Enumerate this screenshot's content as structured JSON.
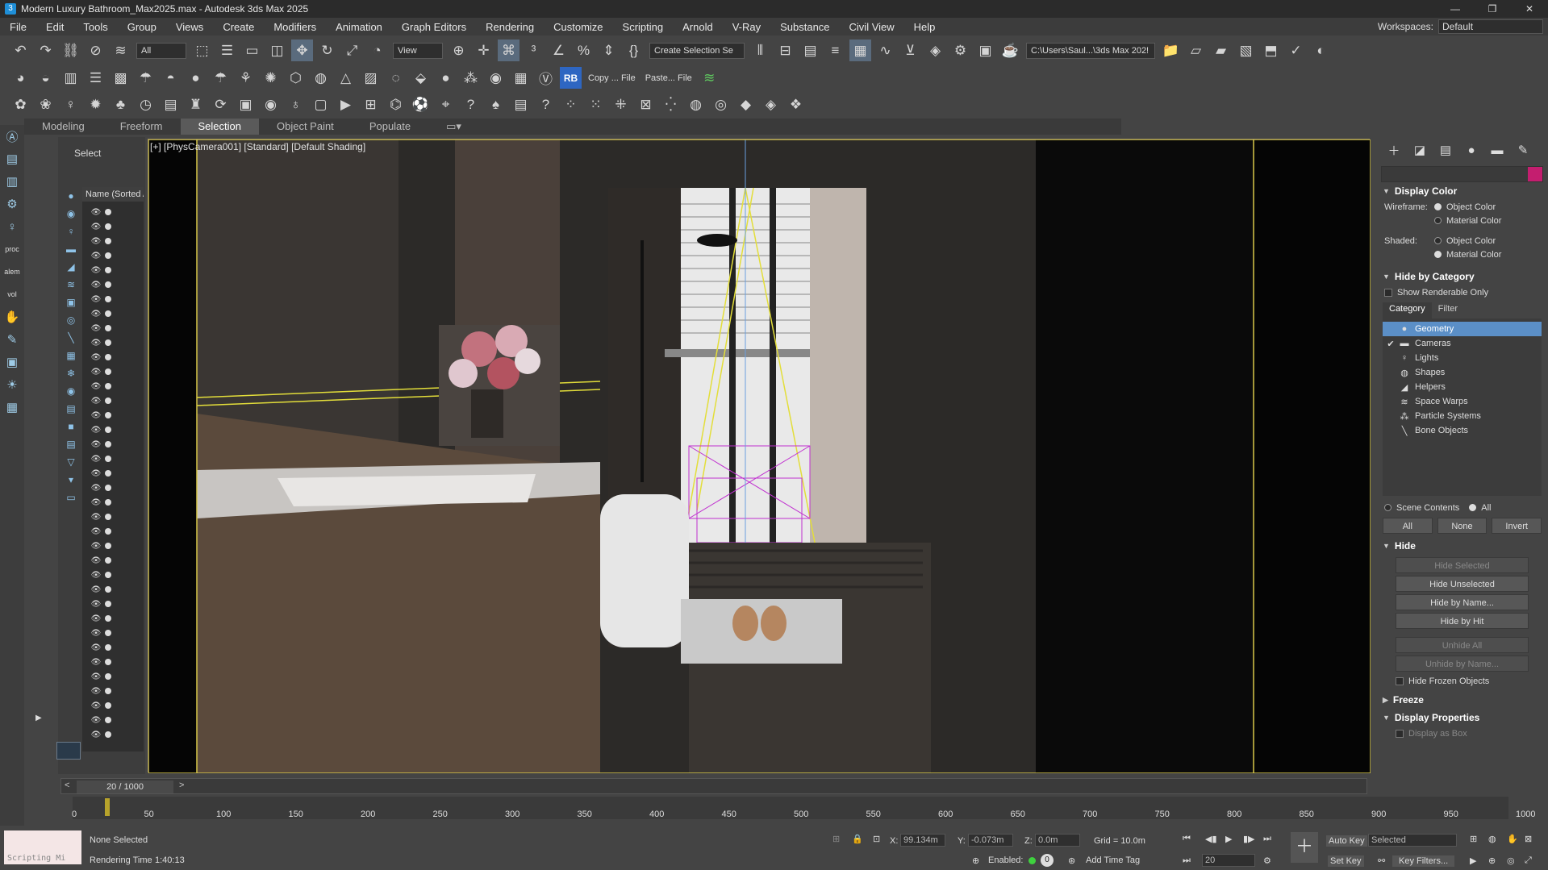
{
  "window": {
    "title": "Modern Luxury Bathroom_Max2025.max - Autodesk 3ds Max 2025",
    "controls": [
      "—",
      "❐",
      "✕"
    ]
  },
  "menu": {
    "items": [
      "File",
      "Edit",
      "Tools",
      "Group",
      "Views",
      "Create",
      "Modifiers",
      "Animation",
      "Graph Editors",
      "Rendering",
      "Customize",
      "Scripting",
      "Arnold",
      "V-Ray",
      "Substance",
      "Civil View",
      "Help"
    ],
    "workspace_label": "Workspaces:",
    "workspace_value": "Default"
  },
  "toolbar1": {
    "filter_value": "All",
    "view_value": "View",
    "selection_set": "Create Selection Se",
    "path_value": "C:\\Users\\Saul...\\3ds Max 202!"
  },
  "toolbar2": {
    "copy_label": "Copy ... File",
    "paste_label": "Paste... File",
    "rb_label": "RB"
  },
  "ribbon": {
    "tabs": [
      "Modeling",
      "Freeform",
      "Selection",
      "Object Paint",
      "Populate"
    ],
    "active": "Selection"
  },
  "left_strip": {
    "labels": [
      "proc",
      "alem",
      "vol"
    ]
  },
  "scene_explorer": {
    "title": "Select",
    "column_header": "Name (Sorted A",
    "rows": 37
  },
  "viewport": {
    "label": "[+] [PhysCamera001] [Standard] [Default Shading]"
  },
  "command_panel": {
    "display_color": {
      "title": "Display Color",
      "wireframe_label": "Wireframe:",
      "shaded_label": "Shaded:",
      "object_color": "Object Color",
      "material_color": "Material Color"
    },
    "hide_by_category": {
      "title": "Hide by Category",
      "show_renderable_only": "Show Renderable Only",
      "tabs": [
        "Category",
        "Filter"
      ],
      "items": [
        {
          "label": "Geometry",
          "checked": false,
          "selected": true,
          "icon": "sphere-icon"
        },
        {
          "label": "Cameras",
          "checked": true,
          "selected": false,
          "icon": "camera-icon"
        },
        {
          "label": "Lights",
          "checked": false,
          "selected": false,
          "icon": "light-icon"
        },
        {
          "label": "Shapes",
          "checked": false,
          "selected": false,
          "icon": "shapes-icon"
        },
        {
          "label": "Helpers",
          "checked": false,
          "selected": false,
          "icon": "helper-icon"
        },
        {
          "label": "Space Warps",
          "checked": false,
          "selected": false,
          "icon": "spacewarp-icon"
        },
        {
          "label": "Particle Systems",
          "checked": false,
          "selected": false,
          "icon": "particle-icon"
        },
        {
          "label": "Bone Objects",
          "checked": false,
          "selected": false,
          "icon": "bone-icon"
        }
      ],
      "scene_contents": "Scene Contents",
      "all_label": "All",
      "buttons": [
        "All",
        "None",
        "Invert"
      ]
    },
    "hide": {
      "title": "Hide",
      "hide_selected": "Hide Selected",
      "hide_unselected": "Hide Unselected",
      "hide_by_name": "Hide by Name...",
      "hide_by_hit": "Hide by Hit",
      "unhide_all": "Unhide All",
      "unhide_by_name": "Unhide by Name...",
      "hide_frozen": "Hide Frozen Objects"
    },
    "freeze_title": "Freeze",
    "display_properties": {
      "title": "Display Properties",
      "display_as_box": "Display as Box"
    }
  },
  "timeline": {
    "frame_display": "20 / 1000",
    "ticks": [
      "0",
      "50",
      "100",
      "150",
      "200",
      "250",
      "300",
      "350",
      "400",
      "450",
      "500",
      "550",
      "600",
      "650",
      "700",
      "750",
      "800",
      "850",
      "900",
      "950",
      "1000"
    ]
  },
  "status": {
    "script_label": "Scripting Mi",
    "selection": "None Selected",
    "render_time_label": "Rendering Time",
    "render_time_value": "1:40:13",
    "x_label": "X:",
    "x_value": "99.134m",
    "y_label": "Y:",
    "y_value": "-0.073m",
    "z_label": "Z:",
    "z_value": "0.0m",
    "grid": "Grid = 10.0m",
    "enabled_label": "Enabled:",
    "add_time_tag": "Add Time Tag",
    "auto_key": "Auto Key",
    "set_key": "Set Key",
    "selected_value": "Selected",
    "key_filters": "Key Filters...",
    "frame_value": "20"
  }
}
